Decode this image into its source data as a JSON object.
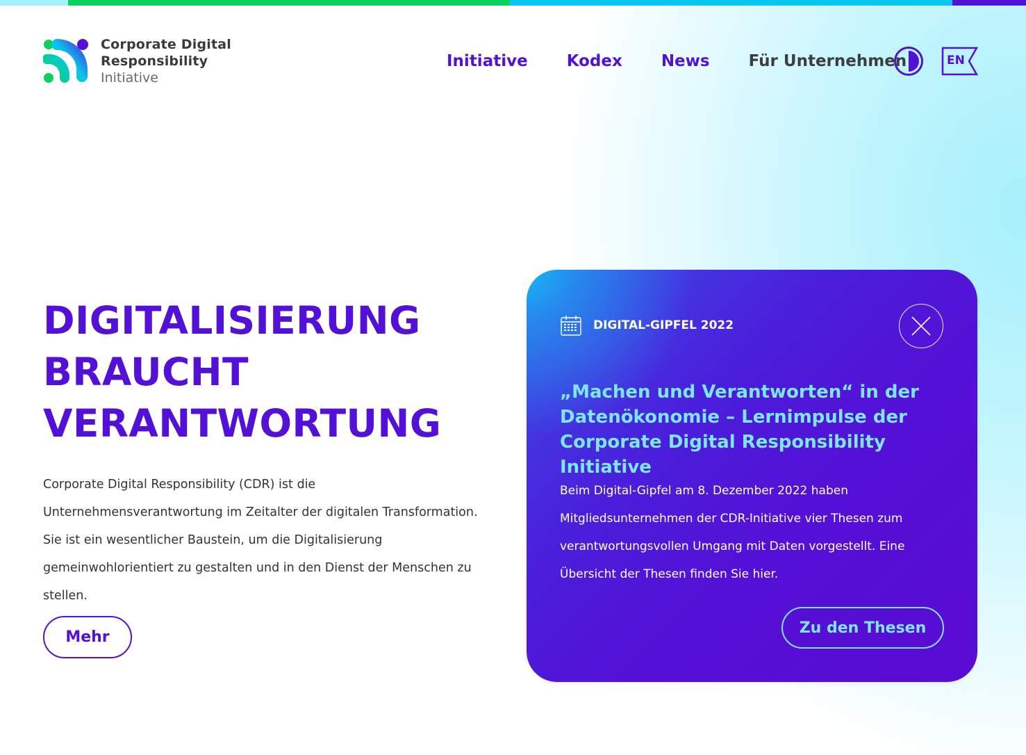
{
  "colors": {
    "accent": "#5311d8",
    "cyan": "#7de6f4",
    "topbar": [
      "#a6f0fb",
      "#08d15c",
      "#08c7ef",
      "#5311d8"
    ]
  },
  "logo": {
    "line1": "Corporate Digital",
    "line2": "Responsibility",
    "line3": "Initiative"
  },
  "nav": {
    "items": [
      {
        "label": "Initiative"
      },
      {
        "label": "Kodex"
      },
      {
        "label": "News"
      },
      {
        "label": "Für Unternehmen"
      }
    ],
    "contrast_icon": "contrast-icon",
    "lang_label": "EN"
  },
  "hero": {
    "title_lines": [
      "DIGITALISIERUNG",
      "BRAUCHT",
      "VERANTWORTUNG"
    ],
    "text": "Corporate Digital Responsibility (CDR) ist die Unternehmensverantwortung im Zeitalter der digitalen Transformation. Sie ist ein wesentlicher Baustein, um die Digitalisierung gemeinwohlorientiert zu gestalten und in den Dienst der Menschen zu stellen.",
    "button_label": "Mehr"
  },
  "card": {
    "label": "DIGITAL-GIPFEL 2022",
    "label_icon": "calendar-icon",
    "close_icon": "close-icon",
    "title": "„Machen und Verantworten“ in der Datenökonomie – Lernimpulse der Corporate Digital Responsibility Initiative",
    "text": "Beim Digital-Gipfel am 8. Dezember 2022 haben Mitgliedsunternehmen der CDR-Initiative vier Thesen zum verantwortungsvollen Umgang mit Daten vorgestellt. Eine Übersicht der Thesen finden Sie hier.",
    "button_label": "Zu den Thesen"
  }
}
